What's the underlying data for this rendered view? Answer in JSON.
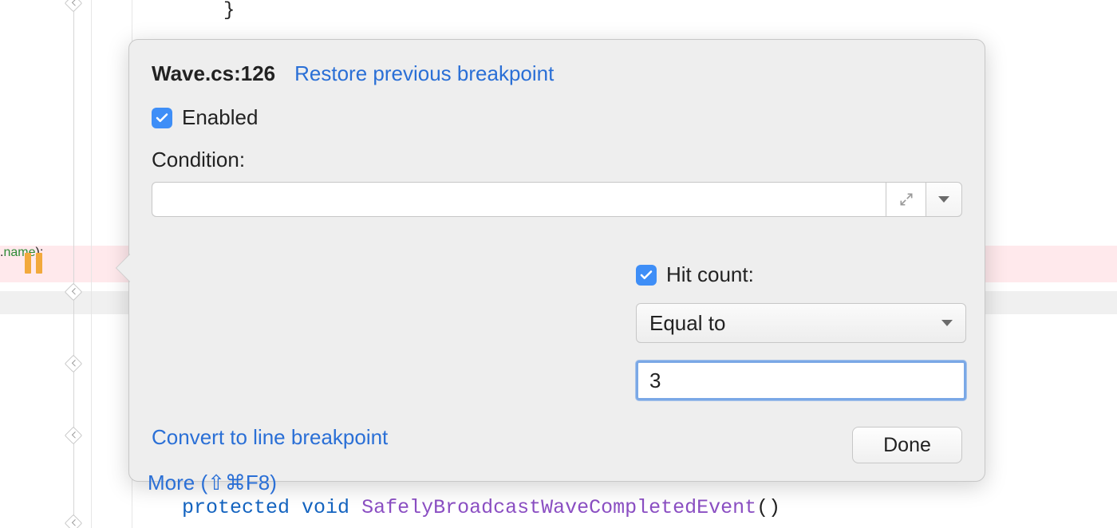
{
  "code": {
    "brace": "}",
    "frag_prop": "name",
    "frag_punct1": ".",
    "frag_punct2": ");",
    "kw1": "protected",
    "kw2": "void",
    "func_name": "SafelyBroadcastWaveCompletedEvent",
    "func_parens": "()"
  },
  "popup": {
    "title": "Wave.cs:126",
    "restore_label": "Restore previous breakpoint",
    "enabled_label": "Enabled",
    "condition_label": "Condition:",
    "condition_value": "",
    "hitcount_label": "Hit count:",
    "hitcount_mode": "Equal to",
    "hitcount_value": "3",
    "convert_label": "Convert to line breakpoint",
    "more_label": "More (⇧⌘F8)",
    "done_label": "Done"
  }
}
